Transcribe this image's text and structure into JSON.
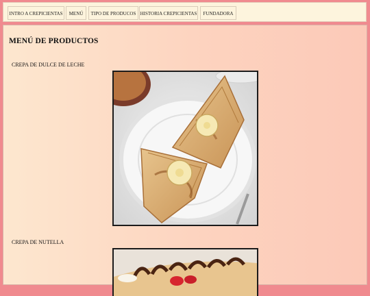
{
  "nav": {
    "items": [
      {
        "label": "INTRO A CREPICIENTAS"
      },
      {
        "label": "MENÚ"
      },
      {
        "label": "TIPO DE PRODUCOS"
      },
      {
        "label": "HISTORIA CREPICIENTAS"
      },
      {
        "label": "FUNDADORA"
      }
    ]
  },
  "main": {
    "title": "MENÚ DE PRODUCTOS",
    "products": [
      {
        "name": "CREPA DE DULCE DE LECHE"
      },
      {
        "name": "CREPA DE NUTELLA"
      }
    ]
  },
  "colors": {
    "page_border": "#f08a8f",
    "nav_bg": "#fdf4dd",
    "content_bg_left": "#fde7cf",
    "content_bg_right": "#fcc9b8"
  }
}
